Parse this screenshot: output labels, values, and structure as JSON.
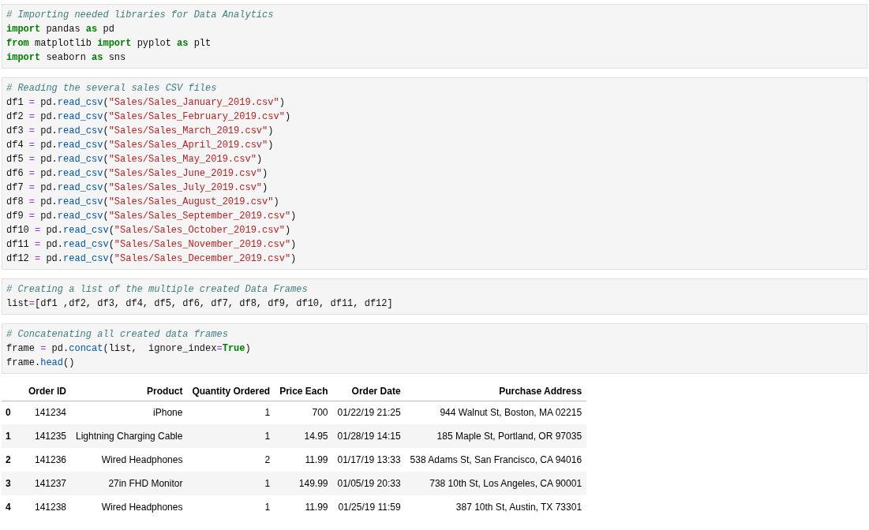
{
  "code_cells": [
    {
      "lines": [
        [
          {
            "kind": "comment",
            "text": "# Importing needed libraries for Data Analytics"
          }
        ],
        [
          {
            "kind": "keyword",
            "text": "import"
          },
          {
            "kind": "plain",
            "text": " pandas "
          },
          {
            "kind": "keyword",
            "text": "as"
          },
          {
            "kind": "plain",
            "text": " pd"
          }
        ],
        [
          {
            "kind": "keyword",
            "text": "from"
          },
          {
            "kind": "plain",
            "text": " matplotlib "
          },
          {
            "kind": "keyword",
            "text": "import"
          },
          {
            "kind": "plain",
            "text": " pyplot "
          },
          {
            "kind": "keyword",
            "text": "as"
          },
          {
            "kind": "plain",
            "text": " plt"
          }
        ],
        [
          {
            "kind": "keyword",
            "text": "import"
          },
          {
            "kind": "plain",
            "text": " seaborn "
          },
          {
            "kind": "keyword",
            "text": "as"
          },
          {
            "kind": "plain",
            "text": " sns"
          }
        ]
      ]
    },
    {
      "lines": [
        [
          {
            "kind": "comment",
            "text": "# Reading the several sales CSV files"
          }
        ],
        [
          {
            "kind": "plain",
            "text": "df1 "
          },
          {
            "kind": "operator",
            "text": "="
          },
          {
            "kind": "plain",
            "text": " pd."
          },
          {
            "kind": "call",
            "text": "read_csv"
          },
          {
            "kind": "plain",
            "text": "("
          },
          {
            "kind": "string",
            "text": "\"Sales/Sales_January_2019.csv\""
          },
          {
            "kind": "plain",
            "text": ")"
          }
        ],
        [
          {
            "kind": "plain",
            "text": "df2 "
          },
          {
            "kind": "operator",
            "text": "="
          },
          {
            "kind": "plain",
            "text": " pd."
          },
          {
            "kind": "call",
            "text": "read_csv"
          },
          {
            "kind": "plain",
            "text": "("
          },
          {
            "kind": "string",
            "text": "\"Sales/Sales_February_2019.csv\""
          },
          {
            "kind": "plain",
            "text": ")"
          }
        ],
        [
          {
            "kind": "plain",
            "text": "df3 "
          },
          {
            "kind": "operator",
            "text": "="
          },
          {
            "kind": "plain",
            "text": " pd."
          },
          {
            "kind": "call",
            "text": "read_csv"
          },
          {
            "kind": "plain",
            "text": "("
          },
          {
            "kind": "string",
            "text": "\"Sales/Sales_March_2019.csv\""
          },
          {
            "kind": "plain",
            "text": ")"
          }
        ],
        [
          {
            "kind": "plain",
            "text": "df4 "
          },
          {
            "kind": "operator",
            "text": "="
          },
          {
            "kind": "plain",
            "text": " pd."
          },
          {
            "kind": "call",
            "text": "read_csv"
          },
          {
            "kind": "plain",
            "text": "("
          },
          {
            "kind": "string",
            "text": "\"Sales/Sales_April_2019.csv\""
          },
          {
            "kind": "plain",
            "text": ")"
          }
        ],
        [
          {
            "kind": "plain",
            "text": "df5 "
          },
          {
            "kind": "operator",
            "text": "="
          },
          {
            "kind": "plain",
            "text": " pd."
          },
          {
            "kind": "call",
            "text": "read_csv"
          },
          {
            "kind": "plain",
            "text": "("
          },
          {
            "kind": "string",
            "text": "\"Sales/Sales_May_2019.csv\""
          },
          {
            "kind": "plain",
            "text": ")"
          }
        ],
        [
          {
            "kind": "plain",
            "text": "df6 "
          },
          {
            "kind": "operator",
            "text": "="
          },
          {
            "kind": "plain",
            "text": " pd."
          },
          {
            "kind": "call",
            "text": "read_csv"
          },
          {
            "kind": "plain",
            "text": "("
          },
          {
            "kind": "string",
            "text": "\"Sales/Sales_June_2019.csv\""
          },
          {
            "kind": "plain",
            "text": ")"
          }
        ],
        [
          {
            "kind": "plain",
            "text": "df7 "
          },
          {
            "kind": "operator",
            "text": "="
          },
          {
            "kind": "plain",
            "text": " pd."
          },
          {
            "kind": "call",
            "text": "read_csv"
          },
          {
            "kind": "plain",
            "text": "("
          },
          {
            "kind": "string",
            "text": "\"Sales/Sales_July_2019.csv\""
          },
          {
            "kind": "plain",
            "text": ")"
          }
        ],
        [
          {
            "kind": "plain",
            "text": "df8 "
          },
          {
            "kind": "operator",
            "text": "="
          },
          {
            "kind": "plain",
            "text": " pd."
          },
          {
            "kind": "call",
            "text": "read_csv"
          },
          {
            "kind": "plain",
            "text": "("
          },
          {
            "kind": "string",
            "text": "\"Sales/Sales_August_2019.csv\""
          },
          {
            "kind": "plain",
            "text": ")"
          }
        ],
        [
          {
            "kind": "plain",
            "text": "df9 "
          },
          {
            "kind": "operator",
            "text": "="
          },
          {
            "kind": "plain",
            "text": " pd."
          },
          {
            "kind": "call",
            "text": "read_csv"
          },
          {
            "kind": "plain",
            "text": "("
          },
          {
            "kind": "string",
            "text": "\"Sales/Sales_September_2019.csv\""
          },
          {
            "kind": "plain",
            "text": ")"
          }
        ],
        [
          {
            "kind": "plain",
            "text": "df10 "
          },
          {
            "kind": "operator",
            "text": "="
          },
          {
            "kind": "plain",
            "text": " pd."
          },
          {
            "kind": "call",
            "text": "read_csv"
          },
          {
            "kind": "plain",
            "text": "("
          },
          {
            "kind": "string",
            "text": "\"Sales/Sales_October_2019.csv\""
          },
          {
            "kind": "plain",
            "text": ")"
          }
        ],
        [
          {
            "kind": "plain",
            "text": "df11 "
          },
          {
            "kind": "operator",
            "text": "="
          },
          {
            "kind": "plain",
            "text": " pd."
          },
          {
            "kind": "call",
            "text": "read_csv"
          },
          {
            "kind": "plain",
            "text": "("
          },
          {
            "kind": "string",
            "text": "\"Sales/Sales_November_2019.csv\""
          },
          {
            "kind": "plain",
            "text": ")"
          }
        ],
        [
          {
            "kind": "plain",
            "text": "df12 "
          },
          {
            "kind": "operator",
            "text": "="
          },
          {
            "kind": "plain",
            "text": " pd."
          },
          {
            "kind": "call",
            "text": "read_csv"
          },
          {
            "kind": "plain",
            "text": "("
          },
          {
            "kind": "string",
            "text": "\"Sales/Sales_December_2019.csv\""
          },
          {
            "kind": "plain",
            "text": ")"
          }
        ]
      ]
    },
    {
      "lines": [
        [
          {
            "kind": "comment",
            "text": "# Creating a list of the multiple created Data Frames"
          }
        ],
        [
          {
            "kind": "plain",
            "text": "list"
          },
          {
            "kind": "operator",
            "text": "="
          },
          {
            "kind": "plain",
            "text": "[df1 ,df2, df3, df4, df5, df6, df7, df8, df9, df10, df11, df12]"
          }
        ]
      ]
    },
    {
      "lines": [
        [
          {
            "kind": "comment",
            "text": "# Concatenating all created data frames"
          }
        ],
        [
          {
            "kind": "plain",
            "text": "frame "
          },
          {
            "kind": "operator",
            "text": "="
          },
          {
            "kind": "plain",
            "text": " pd."
          },
          {
            "kind": "call",
            "text": "concat"
          },
          {
            "kind": "plain",
            "text": "(list,  ignore_index"
          },
          {
            "kind": "operator",
            "text": "="
          },
          {
            "kind": "keyword",
            "text": "True"
          },
          {
            "kind": "plain",
            "text": ")"
          }
        ],
        [
          {
            "kind": "plain",
            "text": "frame."
          },
          {
            "kind": "call",
            "text": "head"
          },
          {
            "kind": "plain",
            "text": "()"
          }
        ]
      ]
    }
  ],
  "table": {
    "columns": [
      "Order ID",
      "Product",
      "Quantity Ordered",
      "Price Each",
      "Order Date",
      "Purchase Address"
    ],
    "rows": [
      {
        "index": "0",
        "cells": [
          "141234",
          "iPhone",
          "1",
          "700",
          "01/22/19 21:25",
          "944 Walnut St, Boston, MA 02215"
        ]
      },
      {
        "index": "1",
        "cells": [
          "141235",
          "Lightning Charging Cable",
          "1",
          "14.95",
          "01/28/19 14:15",
          "185 Maple St, Portland, OR 97035"
        ]
      },
      {
        "index": "2",
        "cells": [
          "141236",
          "Wired Headphones",
          "2",
          "11.99",
          "01/17/19 13:33",
          "538 Adams St, San Francisco, CA 94016"
        ]
      },
      {
        "index": "3",
        "cells": [
          "141237",
          "27in FHD Monitor",
          "1",
          "149.99",
          "01/05/19 20:33",
          "738 10th St, Los Angeles, CA 90001"
        ]
      },
      {
        "index": "4",
        "cells": [
          "141238",
          "Wired Headphones",
          "1",
          "11.99",
          "01/25/19 11:59",
          "387 10th St, Austin, TX 73301"
        ]
      }
    ]
  }
}
